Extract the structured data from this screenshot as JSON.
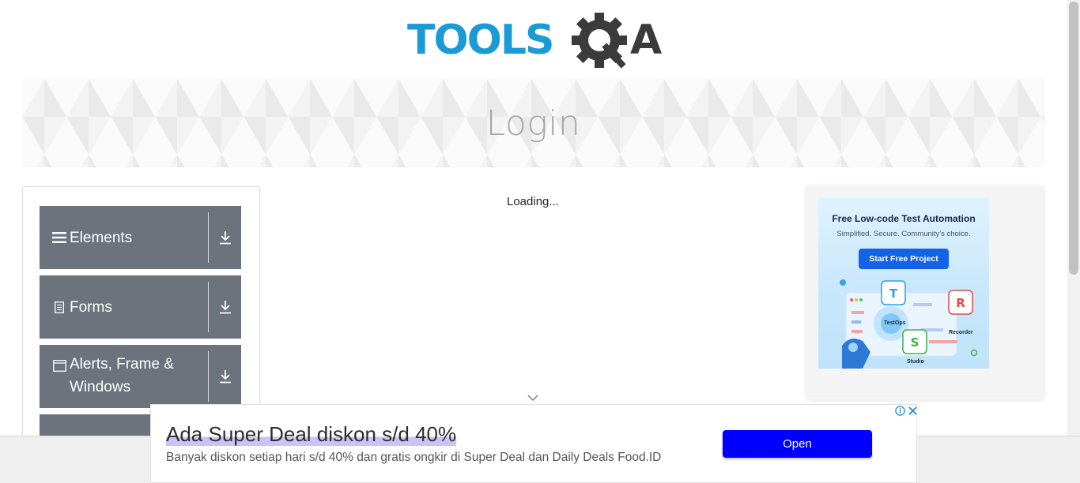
{
  "header": {
    "logo_alt": "TOOLSQA",
    "logo_text_blue": "TOOLS",
    "logo_text_dark": "A"
  },
  "banner": {
    "title": "Login"
  },
  "sidebar": {
    "groups": [
      {
        "label": "Elements",
        "icon": "menu-icon"
      },
      {
        "label": "Forms",
        "icon": "document-icon"
      },
      {
        "label": "Alerts, Frame & Windows",
        "label_line1": "Alerts, Frame &",
        "label_line2": "Windows",
        "icon": "window-icon"
      },
      {
        "label": "",
        "icon": ""
      }
    ]
  },
  "main": {
    "loading_text": "Loading..."
  },
  "side_ad": {
    "headline": "Free Low-code Test Automation",
    "subline": "Simplified. Secure. Community's choice.",
    "button": "Start Free Project",
    "tags": [
      "TestOps",
      "Recorder",
      "Studio"
    ]
  },
  "bottom_ad": {
    "title": "Ada Super Deal diskon s/d 40%",
    "description": "Banyak diskon setiap hari s/d 40% dan gratis ongkir di Super Deal dan Daily Deals Food.ID",
    "button": "Open"
  },
  "colors": {
    "logo_blue": "#1b9ad6",
    "logo_dark": "#3b3b3b",
    "nav_bg": "#6c737c",
    "ad_button": "#0000ff",
    "side_ad_button": "#1462e6"
  }
}
